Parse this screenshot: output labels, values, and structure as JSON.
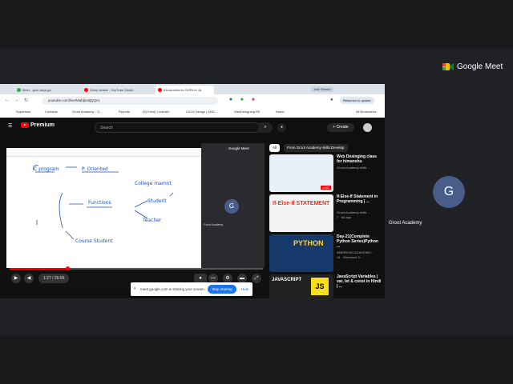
{
  "meet": {
    "brand": "Google Meet",
    "participant_initial": "G",
    "participant_name": "Groot Academy"
  },
  "browser": {
    "tabs": [
      {
        "label": "Meet - gmn-akye-jyx"
      },
      {
        "label": "Video details - YouTube Studio"
      },
      {
        "label": "Introduction to OOPs in Ja"
      }
    ],
    "ask_gemini": "Ask Gemini",
    "url": "youtube.com/live/Mahjko8jQQcs",
    "relaunch": "Relaunch to update",
    "bookmarks": [
      "Superfone",
      "Contacts",
      "Groot Academy - G...",
      "Reports",
      "(5) Feed | LinkedIn",
      "UX/UI Design | AND...",
      "WebDesigning Rtl",
      "Home"
    ],
    "all_bookmarks": "All Bookmarks"
  },
  "youtube": {
    "logo": "Premium",
    "search_placeholder": "Search",
    "create_label": "Create",
    "chips": [
      "All",
      "From Groot Academy skills Develop"
    ],
    "player": {
      "embedded_brand": "Google Meet",
      "embedded_initial": "G",
      "embedded_name": "Groot Academy",
      "time": "1:27 / 26:55",
      "progress": 0.23
    },
    "recommendations": [
      {
        "title": "Web Desinging class for himanshu",
        "channel": "Groot Academy skills ...",
        "meta": "",
        "thumb_text": "LIVE"
      },
      {
        "title": "If-Else-If Statement in Programming | ...",
        "channel": "Groot Academy skills ...",
        "meta": "7 · 84 ago",
        "thumb_text": "If-Else-If STATEMENT"
      },
      {
        "title": "Day-21(Complete Python Series)Python ...",
        "channel": "AMERICAN ACADEMIC...",
        "meta": "14 · Streamed 3...",
        "thumb_text": "PYTHON"
      },
      {
        "title": "JavaScript Variables | var, let & const in Hindi | ...",
        "channel": "",
        "meta": "",
        "thumb_text": "JAVASCRIPT"
      }
    ]
  },
  "whiteboard": {
    "notes": [
      "C program",
      "P. Oriented",
      "College mamnt",
      "Functions",
      "Student",
      "Teacher",
      "Course Student"
    ]
  },
  "share_banner": {
    "text": "meet.google.com is sharing your screen.",
    "stop_label": "Stop sharing",
    "hide_label": "Hide"
  },
  "colors": {
    "accent_red": "#ff0000",
    "meet_blue": "#1a73e8"
  }
}
